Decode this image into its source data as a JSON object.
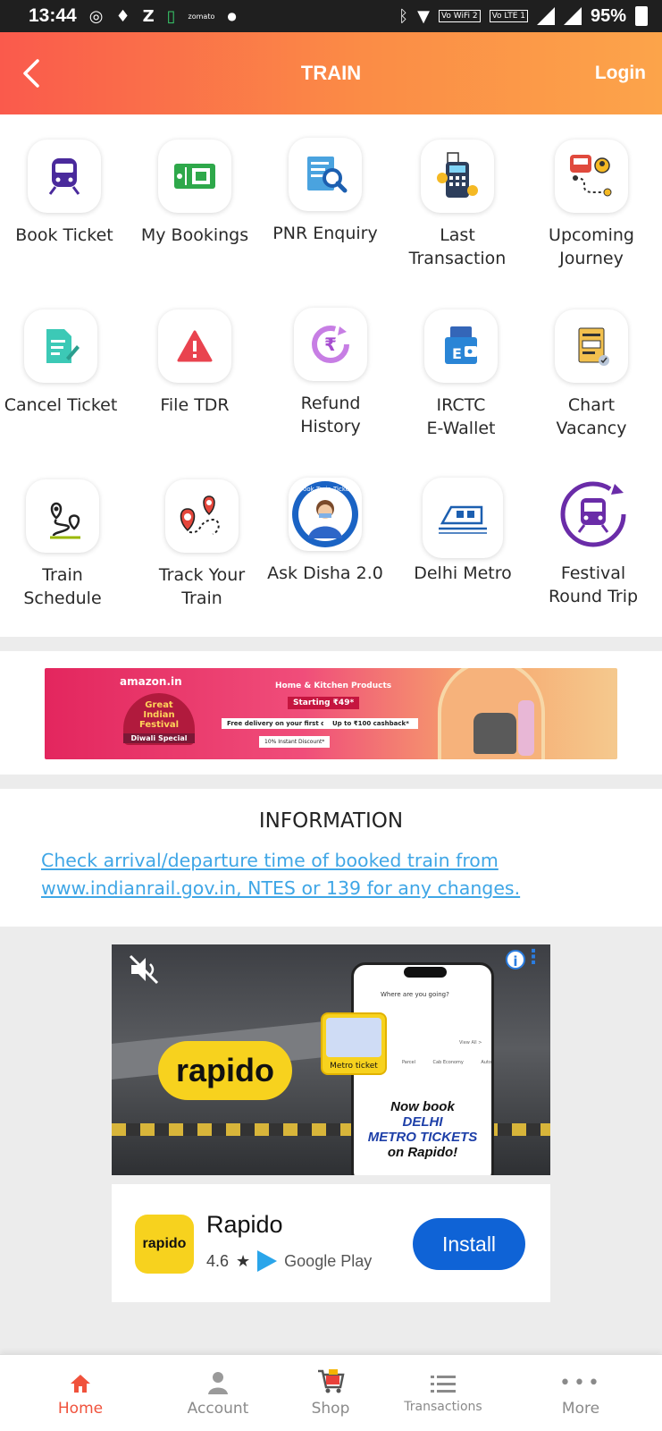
{
  "status_bar": {
    "time": "13:44",
    "left_icons": [
      "whatsapp-icon",
      "gps-icon",
      "zee-icon",
      "battery-app-icon",
      "zomato-icon",
      "dot-icon"
    ],
    "zomato_text": "zomato",
    "wifi_tag": "Vo WiFi 2",
    "lte_tag": "Vo LTE 1",
    "battery": "95%"
  },
  "header": {
    "title": "TRAIN",
    "login_label": "Login",
    "gradient_start": "#fa5a4c",
    "gradient_end": "#fca44a"
  },
  "grid": {
    "items": [
      {
        "label": "Book Ticket",
        "icon": "train-icon"
      },
      {
        "label": "My Bookings",
        "icon": "ticket-icon"
      },
      {
        "label": "PNR Enquiry",
        "icon": "document-search-icon"
      },
      {
        "label": "Last\nTransaction",
        "icon": "pos-machine-icon"
      },
      {
        "label": "Upcoming\nJourney",
        "icon": "journey-route-icon"
      },
      {
        "label": "Cancel Ticket",
        "icon": "edit-document-icon"
      },
      {
        "label": "File TDR",
        "icon": "warning-icon"
      },
      {
        "label": "Refund\nHistory",
        "icon": "rupee-refresh-icon"
      },
      {
        "label": "IRCTC\nE-Wallet",
        "icon": "wallet-icon"
      },
      {
        "label": "Chart\nVacancy",
        "icon": "chart-icon"
      },
      {
        "label": "Train\nSchedule",
        "icon": "route-pin-icon"
      },
      {
        "label": "Track Your\nTrain",
        "icon": "track-location-icon"
      },
      {
        "label": "Ask Disha 2.0",
        "icon": "disha-avatar-icon"
      },
      {
        "label": "Delhi Metro",
        "icon": "metro-icon"
      },
      {
        "label": "Festival\nRound Trip",
        "icon": "round-trip-train-icon"
      }
    ]
  },
  "amazon_banner": {
    "logo": "amazon.in",
    "festival": "Great\nIndian\nFestival",
    "festival_sub": "Diwali Special",
    "headline": "Home & Kitchen Products",
    "starting": "Starting ₹49*",
    "perk1": "Free delivery on your first order",
    "perk2": "Up to ₹100 cashback*",
    "discount": "10% Instant Discount*"
  },
  "information": {
    "title": "INFORMATION",
    "link_text": "Check arrival/departure time of booked train from www.indianrail.gov.in, NTES or 139 for any changes."
  },
  "ad": {
    "brand": "rapido",
    "phone_search": "Where are you going?",
    "phone_view_all": "View All >",
    "phone_tiles": [
      "Parcel",
      "Cab Economy",
      "Auto"
    ],
    "metro_tile_label": "Metro ticket",
    "cta_line1": "Now book",
    "cta_line2": "DELHI",
    "cta_line3": "METRO TICKETS",
    "cta_line4": "on Rapido!",
    "app_icon_text": "rapido",
    "app_name": "Rapido",
    "rating": "4.6",
    "store": "Google Play",
    "install_label": "Install"
  },
  "bottom_nav": {
    "items": [
      {
        "label": "Home",
        "icon": "home-icon",
        "active": true
      },
      {
        "label": "Account",
        "icon": "person-icon",
        "active": false
      },
      {
        "label": "Shop",
        "icon": "cart-icon",
        "active": false
      },
      {
        "label": "Transactions",
        "icon": "list-icon",
        "active": false
      },
      {
        "label": "More",
        "icon": "more-dots-icon",
        "active": false
      }
    ],
    "active_color": "#f0523c"
  }
}
